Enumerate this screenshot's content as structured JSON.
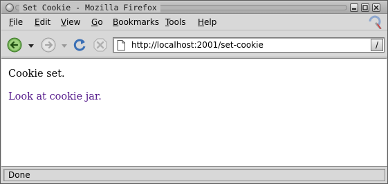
{
  "window": {
    "title": "Set Cookie - Mozilla Firefox"
  },
  "menu": {
    "items": [
      {
        "label": "File",
        "mnemonic": "F",
        "rest": "ile"
      },
      {
        "label": "Edit",
        "mnemonic": "E",
        "rest": "dit"
      },
      {
        "label": "View",
        "mnemonic": "V",
        "rest": "iew"
      },
      {
        "label": "Go",
        "mnemonic": "G",
        "rest": "o"
      },
      {
        "label": "Bookmarks",
        "mnemonic": "B",
        "rest": "ookmarks"
      },
      {
        "label": "Tools",
        "mnemonic": "T",
        "rest": "ools"
      },
      {
        "label": "Help",
        "mnemonic": "H",
        "rest": "elp"
      }
    ]
  },
  "toolbar": {
    "back_icon": "back-arrow-icon",
    "forward_icon": "forward-arrow-icon",
    "reload_icon": "reload-icon",
    "stop_icon": "stop-icon",
    "go_label": "/"
  },
  "address": {
    "url": "http://localhost:2001/set-cookie"
  },
  "page": {
    "message": "Cookie set.",
    "link_text": "Look at cookie jar.",
    "link_color": "#551a8b"
  },
  "status": {
    "text": "Done"
  }
}
